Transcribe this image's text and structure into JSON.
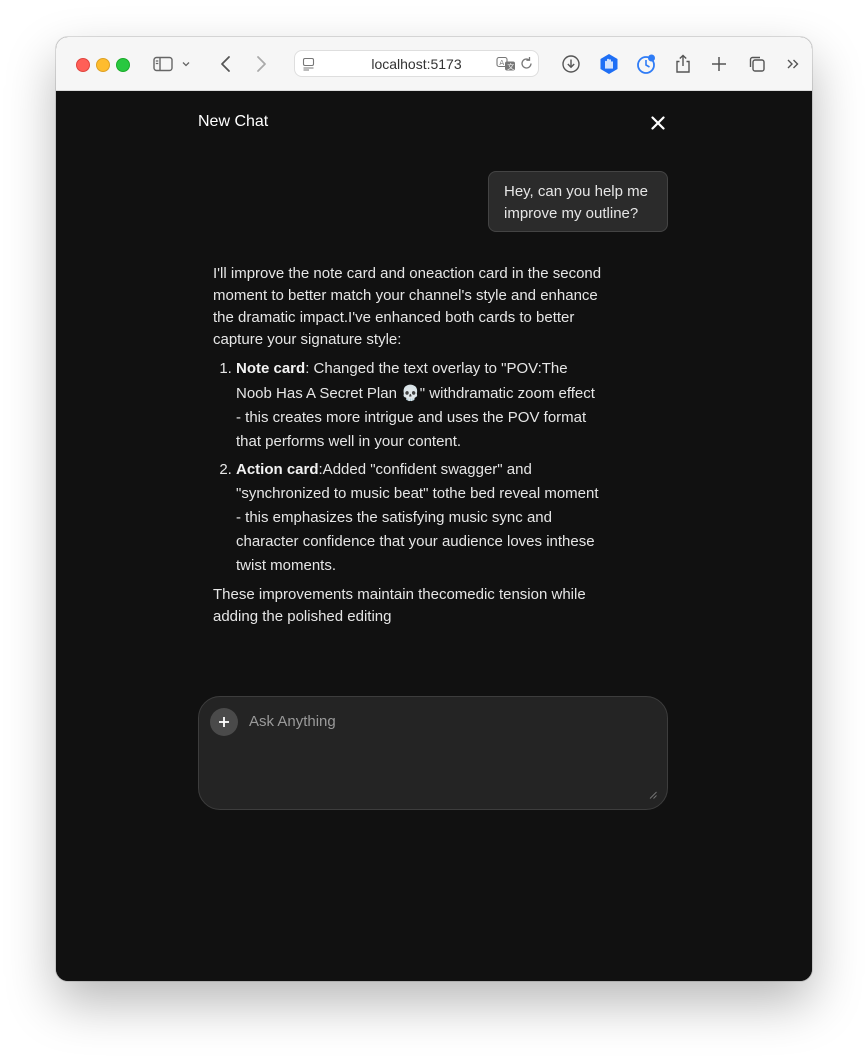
{
  "browser": {
    "url": "localhost:5173"
  },
  "chat": {
    "title": "New Chat",
    "user_message": "Hey, can you help me improve my outline?",
    "assistant": {
      "intro": "I'll improve the note card and oneaction card in the second moment to better match your channel's style and enhance the dramatic impact.I've enhanced both cards to better capture your signature style:",
      "items": [
        {
          "number": "1.",
          "bold": "Note card",
          "text_before_emoji": ": Changed the text overlay to \"POV:The Noob Has A Secret Plan ",
          "emoji": "💀",
          "text_after_emoji": "\" withdramatic zoom effect - this creates more intrigue and uses the POV format that performs well in your content."
        },
        {
          "number": "2.",
          "bold": "Action card",
          "text": ":Added \"confident swagger\" and \"synchronized to music beat\" tothe bed reveal moment - this emphasizes the satisfying music sync and character confidence that your audience loves inthese twist moments."
        }
      ],
      "outro": "These improvements maintain thecomedic tension while adding the polished editing"
    },
    "input": {
      "placeholder": "Ask Anything",
      "value": ""
    }
  },
  "icons": {
    "close": "close-icon",
    "plus": "plus-icon"
  },
  "colors": {
    "background": "#111111",
    "bubble": "#2b2b2b",
    "input_bg": "#242424",
    "text": "#e6e6e6"
  }
}
